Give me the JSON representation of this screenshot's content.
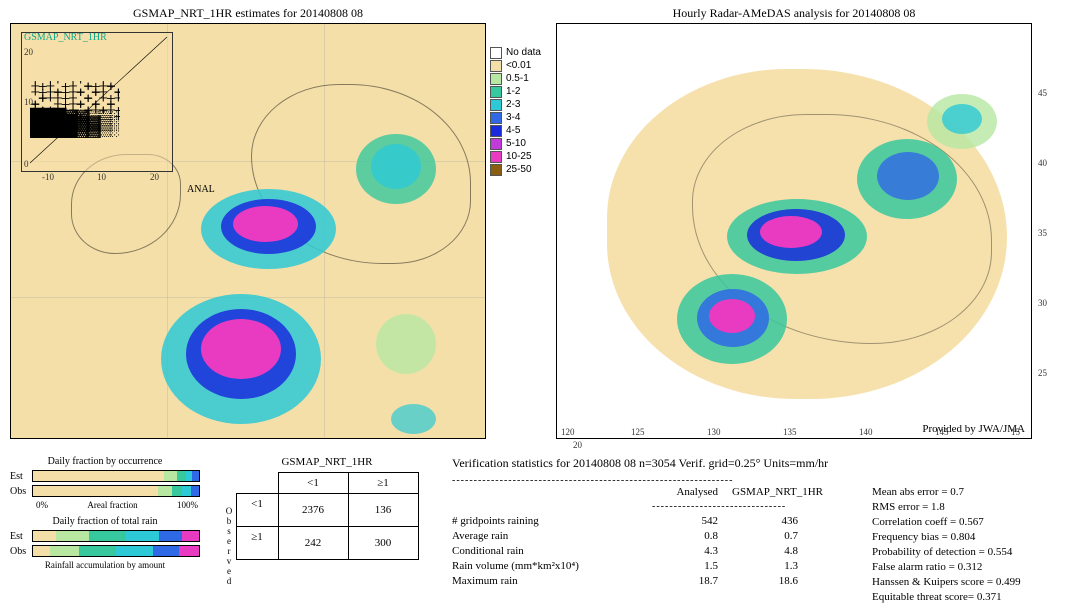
{
  "left_map": {
    "title": "GSMAP_NRT_1HR estimates for 20140808 08",
    "inset_label": "GSMAP_NRT_1HR",
    "anal_label": "ANAL",
    "inset_ticks": [
      "20",
      "10",
      "0",
      "-10",
      "10",
      "20"
    ]
  },
  "right_map": {
    "title": "Hourly Radar-AMeDAS analysis for 20140808 08",
    "provided": "Provided by JWA/JMA",
    "lon_ticks": [
      "120",
      "125",
      "130",
      "135",
      "140",
      "145",
      "15"
    ],
    "lat_ticks": [
      "45",
      "40",
      "35",
      "30",
      "25",
      "20"
    ],
    "lat_bottom": "20"
  },
  "legend": [
    {
      "c": "#ffffff",
      "t": "No data"
    },
    {
      "c": "#f5dfa9",
      "t": "<0.01"
    },
    {
      "c": "#b8e7a2",
      "t": "0.5-1"
    },
    {
      "c": "#37c89e",
      "t": "1-2"
    },
    {
      "c": "#2dc9d6",
      "t": "2-3"
    },
    {
      "c": "#2f69e5",
      "t": "3-4"
    },
    {
      "c": "#1a2bdc",
      "t": "4-5"
    },
    {
      "c": "#c03bd8",
      "t": "5-10"
    },
    {
      "c": "#e93bc2",
      "t": "10-25"
    },
    {
      "c": "#8a5d10",
      "t": "25-50"
    }
  ],
  "bars": {
    "occ_title": "Daily fraction by occurrence",
    "rain_title": "Daily fraction of total rain",
    "acc_title": "Rainfall accumulation by amount",
    "areal_fraction": "Areal fraction",
    "est": "Est",
    "obs": "Obs",
    "p0": "0%",
    "p100": "100%"
  },
  "ctable": {
    "title": "GSMAP_NRT_1HR",
    "side": "Observed",
    "lt": "<1",
    "ge": "≥1",
    "cells": {
      "tl": "2376",
      "tr": "136",
      "bl": "242",
      "br": "300"
    }
  },
  "stats": {
    "title": "Verification statistics for 20140808 08   n=3054   Verif. grid=0.25°   Units=mm/hr",
    "col_analysed": "Analysed",
    "col_gsmap": "GSMAP_NRT_1HR",
    "rows": [
      {
        "label": "# gridpoints raining",
        "a": "542",
        "b": "436"
      },
      {
        "label": "Average rain",
        "a": "0.8",
        "b": "0.7"
      },
      {
        "label": "Conditional rain",
        "a": "4.3",
        "b": "4.8"
      },
      {
        "label": "Rain volume (mm*km²x10⁴)",
        "a": "1.5",
        "b": "1.3"
      },
      {
        "label": "Maximum rain",
        "a": "18.7",
        "b": "18.6"
      }
    ],
    "metrics": [
      "Mean abs error = 0.7",
      "RMS error = 1.8",
      "Correlation coeff = 0.567",
      "Frequency bias = 0.804",
      "Probability of detection = 0.554",
      "False alarm ratio = 0.312",
      "Hanssen & Kuipers score = 0.499",
      "Equitable threat score= 0.371"
    ]
  },
  "chart_data": {
    "type": "table",
    "title": "Verification statistics for 20140808 08",
    "n": 3054,
    "verif_grid_deg": 0.25,
    "units": "mm/hr",
    "contingency": {
      "observed_lt1_est_lt1": 2376,
      "observed_lt1_est_ge1": 136,
      "observed_ge1_est_lt1": 242,
      "observed_ge1_est_ge1": 300
    },
    "summary": {
      "gridpoints_raining": {
        "analysed": 542,
        "gsmap_nrt_1hr": 436
      },
      "average_rain": {
        "analysed": 0.8,
        "gsmap_nrt_1hr": 0.7
      },
      "conditional_rain": {
        "analysed": 4.3,
        "gsmap_nrt_1hr": 4.8
      },
      "rain_volume_mm_km2_x1e4": {
        "analysed": 1.5,
        "gsmap_nrt_1hr": 1.3
      },
      "maximum_rain": {
        "analysed": 18.7,
        "gsmap_nrt_1hr": 18.6
      }
    },
    "scores": {
      "mean_abs_error": 0.7,
      "rms_error": 1.8,
      "correlation_coeff": 0.567,
      "frequency_bias": 0.804,
      "probability_of_detection": 0.554,
      "false_alarm_ratio": 0.312,
      "hanssen_kuipers_score": 0.499,
      "equitable_threat_score": 0.371
    },
    "legend_bins_mm_per_hr": [
      "No data",
      "<0.01",
      "0.5-1",
      "1-2",
      "2-3",
      "3-4",
      "4-5",
      "5-10",
      "10-25",
      "25-50"
    ]
  }
}
